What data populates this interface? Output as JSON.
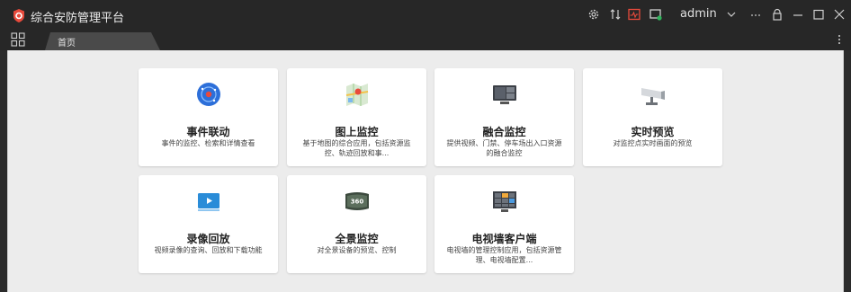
{
  "app": {
    "title": "综合安防管理平台",
    "user": "admin"
  },
  "tabs": [
    {
      "label": "首页"
    }
  ],
  "cards": [
    {
      "title": "事件联动",
      "desc": "事件的监控、检索和详情查看",
      "icon": "event-icon"
    },
    {
      "title": "图上监控",
      "desc": "基于地图的综合应用，包括资源监控、轨迹回放和事...",
      "icon": "map-icon"
    },
    {
      "title": "融合监控",
      "desc": "提供视频、门禁、停车场出入口资源的融合监控",
      "icon": "monitor-icon"
    },
    {
      "title": "实时预览",
      "desc": "对监控点实时画面的预览",
      "icon": "camera-icon"
    },
    {
      "title": "录像回放",
      "desc": "视频录像的查询、回放和下载功能",
      "icon": "playback-icon"
    },
    {
      "title": "全景监控",
      "desc": "对全景设备的预览、控制",
      "icon": "panorama-icon"
    },
    {
      "title": "电视墙客户端",
      "desc": "电视墙的管理控制应用，包括资源管理、电视墙配置...",
      "icon": "tv-wall-icon"
    }
  ],
  "colors": {
    "accent": "#e84a3c",
    "titlebar": "#272727",
    "background": "#ececec"
  }
}
